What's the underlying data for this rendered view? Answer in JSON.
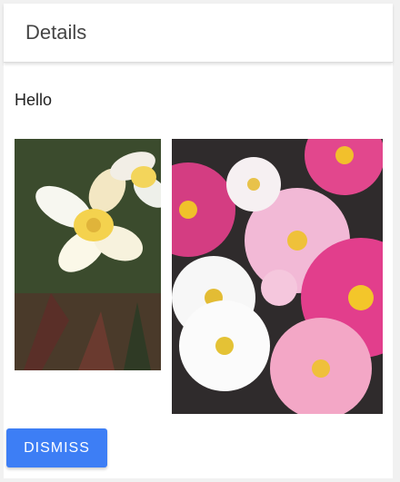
{
  "dialog": {
    "title": "Details",
    "message": "Hello",
    "dismiss_label": "DISMISS"
  },
  "images": [
    {
      "subject": "yellow-white frangipani flower"
    },
    {
      "subject": "pink and white cosmos flowers"
    }
  ],
  "colors": {
    "accent": "#3d7ef5",
    "background": "#f1f1f1"
  }
}
